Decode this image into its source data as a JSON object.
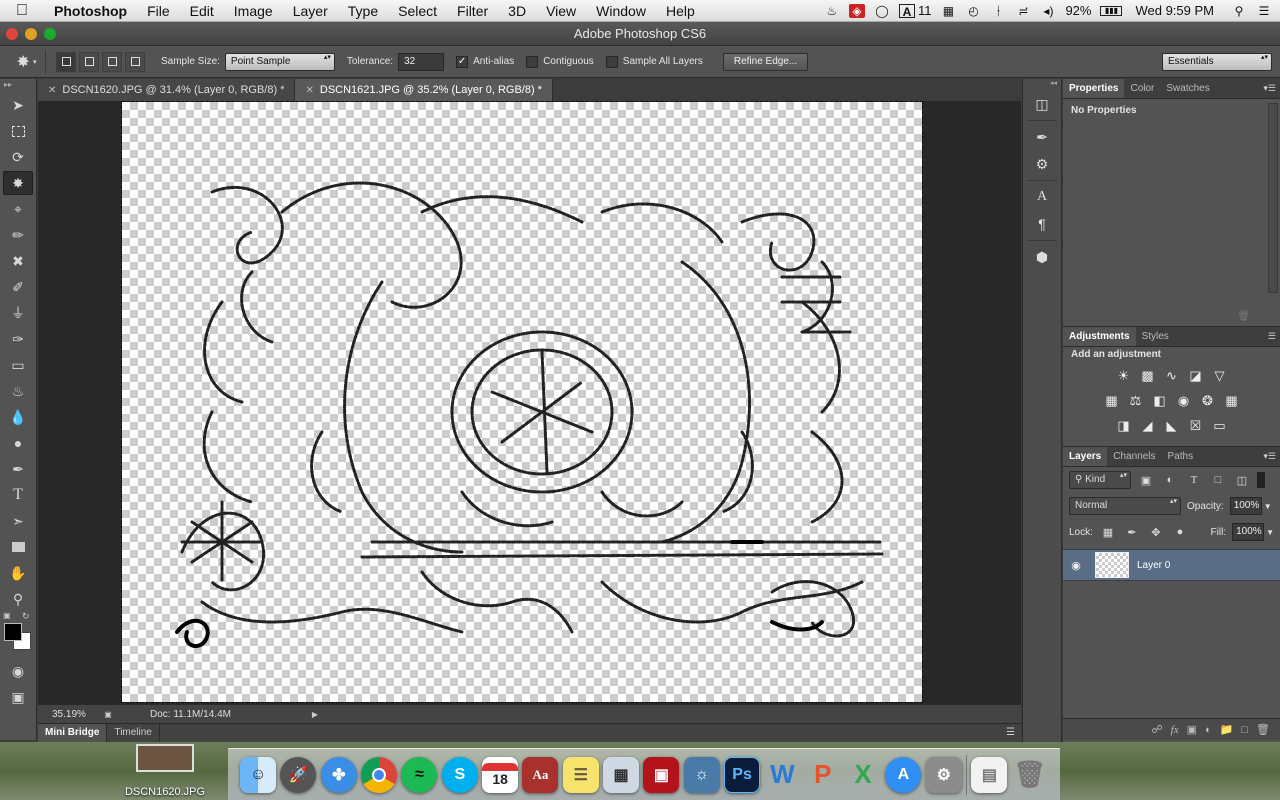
{
  "menubar": {
    "app_name": "Photoshop",
    "items": [
      "File",
      "Edit",
      "Image",
      "Layer",
      "Type",
      "Select",
      "Filter",
      "3D",
      "View",
      "Window",
      "Help"
    ],
    "adobe_count": "11",
    "battery": "92%",
    "clock": "Wed 9:59 PM"
  },
  "window": {
    "title": "Adobe Photoshop CS6"
  },
  "options": {
    "sample_size_label": "Sample Size:",
    "sample_size_value": "Point Sample",
    "tolerance_label": "Tolerance:",
    "tolerance_value": "32",
    "antialias_label": "Anti-alias",
    "antialias_checked": true,
    "contiguous_label": "Contiguous",
    "contiguous_checked": false,
    "sample_all_label": "Sample All Layers",
    "sample_all_checked": false,
    "refine_edge_label": "Refine Edge...",
    "workspace_value": "Essentials"
  },
  "tabs": [
    {
      "label": "DSCN1620.JPG @ 31.4% (Layer 0, RGB/8) *",
      "active": false
    },
    {
      "label": "DSCN1621.JPG @ 35.2% (Layer 0, RGB/8) *",
      "active": true
    }
  ],
  "status": {
    "zoom": "35.19%",
    "doc_info": "Doc: 11.1M/14.4M"
  },
  "bottom_tabs": [
    "Mini Bridge",
    "Timeline"
  ],
  "properties_panel": {
    "tabs": [
      "Properties",
      "Color",
      "Swatches"
    ],
    "body_text": "No Properties"
  },
  "adjustments_panel": {
    "tabs": [
      "Adjustments",
      "Styles"
    ],
    "heading": "Add an adjustment"
  },
  "layers_panel": {
    "tabs": [
      "Layers",
      "Channels",
      "Paths"
    ],
    "kind_filter": "Kind",
    "blend_mode": "Normal",
    "opacity_label": "Opacity:",
    "opacity_value": "100%",
    "lock_label": "Lock:",
    "fill_label": "Fill:",
    "fill_value": "100%",
    "layer_name": "Layer 0"
  },
  "desktop": {
    "file_label": "DSCN1620.JPG",
    "dock_calendar_day": "18"
  },
  "colors": {
    "ui_panel": "#535353",
    "canvas_bg": "#282828",
    "layer_selected": "#5a6d86",
    "foreground_color": "#000000",
    "background_color": "#ffffff"
  }
}
